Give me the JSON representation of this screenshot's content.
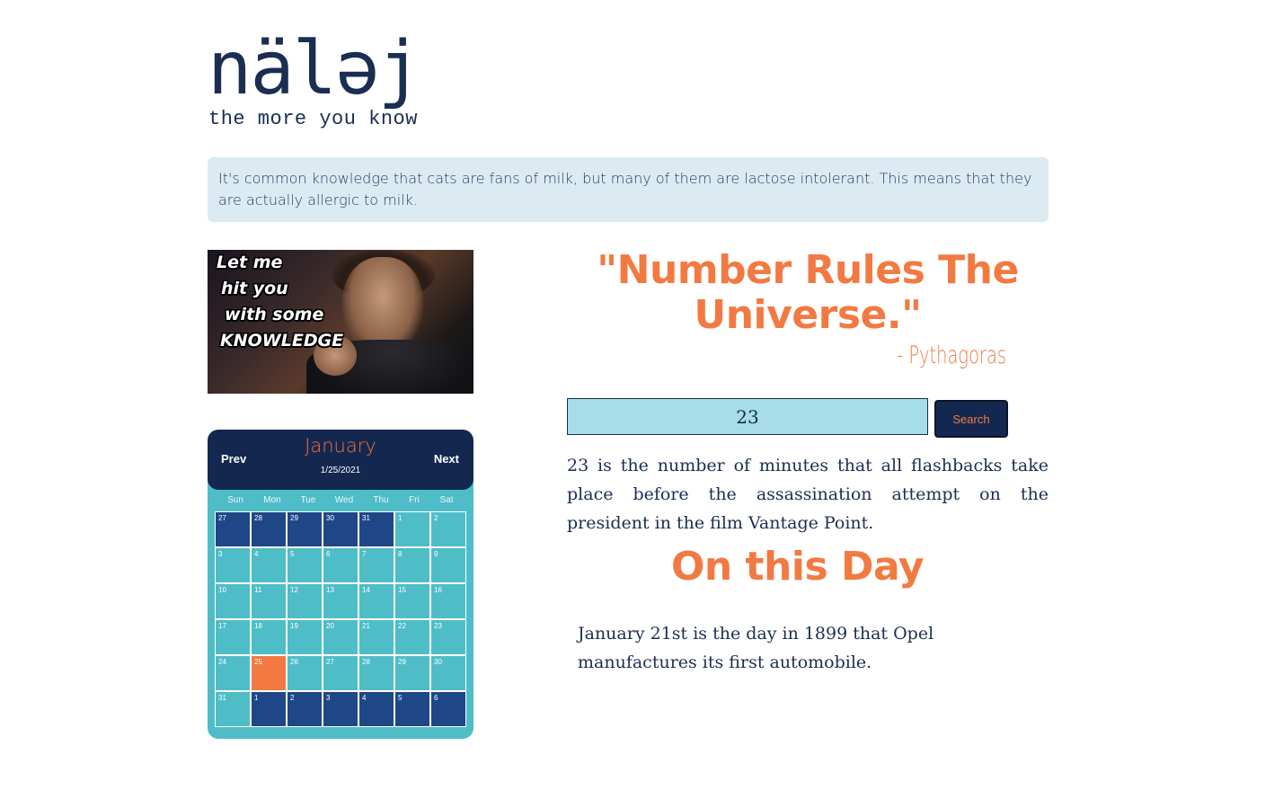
{
  "logo": {
    "word": "näləj",
    "tagline": "the more you know"
  },
  "fact_banner": {
    "text": "It's common knowledge that cats are fans of milk, but many of them are lactose intolerant. This means that they are actually allergic to milk."
  },
  "meme": {
    "caption_lines": [
      "Let me",
      "hit you",
      "with some",
      "KNOWLEDGE"
    ]
  },
  "calendar": {
    "prev_label": "Prev",
    "next_label": "Next",
    "month": "January",
    "selected_date": "1/25/2021",
    "weekdays": [
      "Sun",
      "Mon",
      "Tue",
      "Wed",
      "Thu",
      "Fri",
      "Sat"
    ],
    "weeks": [
      [
        {
          "d": "27",
          "t": "other"
        },
        {
          "d": "28",
          "t": "other"
        },
        {
          "d": "29",
          "t": "other"
        },
        {
          "d": "30",
          "t": "other"
        },
        {
          "d": "31",
          "t": "other"
        },
        {
          "d": "1",
          "t": "cur"
        },
        {
          "d": "2",
          "t": "cur"
        }
      ],
      [
        {
          "d": "3",
          "t": "cur"
        },
        {
          "d": "4",
          "t": "cur"
        },
        {
          "d": "5",
          "t": "cur"
        },
        {
          "d": "6",
          "t": "cur"
        },
        {
          "d": "7",
          "t": "cur"
        },
        {
          "d": "8",
          "t": "cur"
        },
        {
          "d": "9",
          "t": "cur"
        }
      ],
      [
        {
          "d": "10",
          "t": "cur"
        },
        {
          "d": "11",
          "t": "cur"
        },
        {
          "d": "12",
          "t": "cur"
        },
        {
          "d": "13",
          "t": "cur"
        },
        {
          "d": "14",
          "t": "cur"
        },
        {
          "d": "15",
          "t": "cur"
        },
        {
          "d": "16",
          "t": "cur"
        }
      ],
      [
        {
          "d": "17",
          "t": "cur"
        },
        {
          "d": "18",
          "t": "cur"
        },
        {
          "d": "19",
          "t": "cur"
        },
        {
          "d": "20",
          "t": "cur"
        },
        {
          "d": "21",
          "t": "cur"
        },
        {
          "d": "22",
          "t": "cur"
        },
        {
          "d": "23",
          "t": "cur"
        }
      ],
      [
        {
          "d": "24",
          "t": "cur"
        },
        {
          "d": "25",
          "t": "sel"
        },
        {
          "d": "26",
          "t": "cur"
        },
        {
          "d": "27",
          "t": "cur"
        },
        {
          "d": "28",
          "t": "cur"
        },
        {
          "d": "29",
          "t": "cur"
        },
        {
          "d": "30",
          "t": "cur"
        }
      ],
      [
        {
          "d": "31",
          "t": "cur"
        },
        {
          "d": "1",
          "t": "other"
        },
        {
          "d": "2",
          "t": "other"
        },
        {
          "d": "3",
          "t": "other"
        },
        {
          "d": "4",
          "t": "other"
        },
        {
          "d": "5",
          "t": "other"
        },
        {
          "d": "6",
          "t": "other"
        }
      ]
    ]
  },
  "quote": {
    "text": "\"Number Rules The Universe.\"",
    "author": "- Pythagoras"
  },
  "search": {
    "value": "23",
    "button_label": "Search"
  },
  "number_fact": {
    "text": "23 is the number of minutes that all flashbacks take place before the assassination attempt on the president in the film Vantage Point."
  },
  "on_this_day": {
    "title": "On this Day",
    "text": "January 21st is the day in 1899 that Opel manufactures its first automobile."
  },
  "colors": {
    "accent": "#f27a42",
    "navy": "#14284f",
    "teal": "#4fbdc8",
    "input_bg": "#a6dde9",
    "banner_bg": "#dcebf2"
  }
}
